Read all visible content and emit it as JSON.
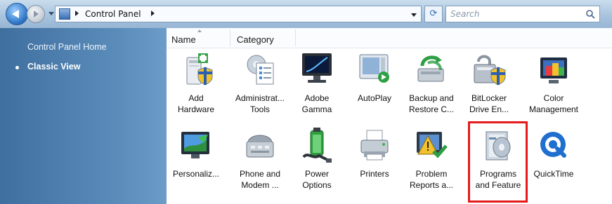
{
  "toolbar": {
    "address_path": "Control Panel",
    "search_placeholder": "Search"
  },
  "sidebar": {
    "items": [
      {
        "label": "Control Panel Home"
      },
      {
        "label": "Classic View"
      }
    ]
  },
  "columns": [
    "Name",
    "Category"
  ],
  "items": [
    {
      "label1": "Add",
      "label2": "Hardware"
    },
    {
      "label1": "Administrat...",
      "label2": "Tools"
    },
    {
      "label1": "Adobe",
      "label2": "Gamma"
    },
    {
      "label1": "AutoPlay",
      "label2": ""
    },
    {
      "label1": "Backup and",
      "label2": "Restore C..."
    },
    {
      "label1": "BitLocker",
      "label2": "Drive En..."
    },
    {
      "label1": "Color",
      "label2": "Management"
    },
    {
      "label1": "Personaliz...",
      "label2": ""
    },
    {
      "label1": "Phone and",
      "label2": "Modem ..."
    },
    {
      "label1": "Power",
      "label2": "Options"
    },
    {
      "label1": "Printers",
      "label2": ""
    },
    {
      "label1": "Problem",
      "label2": "Reports a..."
    },
    {
      "label1": "Programs",
      "label2": "and Feature"
    },
    {
      "label1": "QuickTime",
      "label2": ""
    }
  ],
  "highlight": {
    "item": "Programs and Feature",
    "color": "#e31b1b"
  },
  "colors": {
    "sidebar": "#4f80b0",
    "topbar": "#a9c4de"
  }
}
